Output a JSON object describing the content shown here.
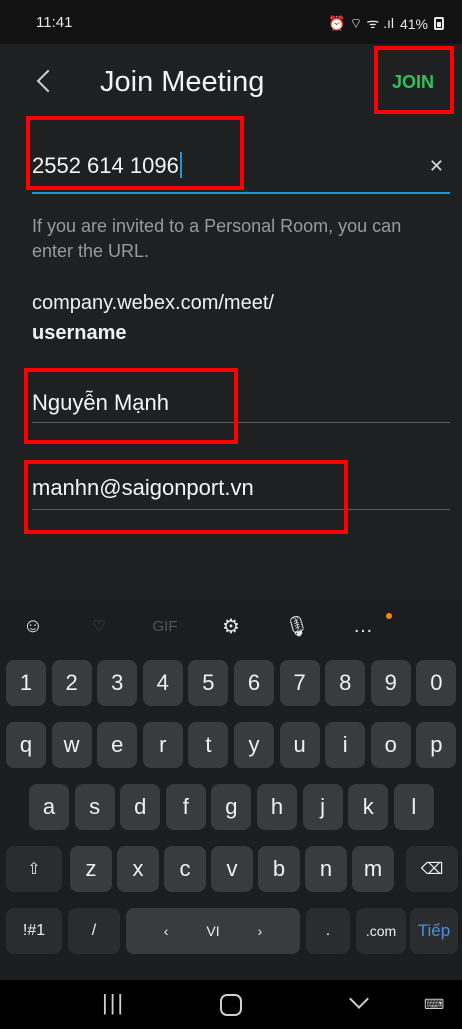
{
  "status": {
    "time": "11:41",
    "battery": "41%",
    "signal_icons": "⏰ ⌔ ᯤ .ıl"
  },
  "header": {
    "title": "Join Meeting",
    "join_label": "JOIN"
  },
  "form": {
    "meeting_number": "2552 614 1096",
    "hint": "If you are invited to a Personal Room, you can enter the URL.",
    "url_prefix": "company.webex.com/meet/",
    "url_suffix": "username",
    "name": "Nguyễn Mạnh",
    "email": "manhn@saigonport.vn"
  },
  "keyboard": {
    "toolbar": [
      "☺",
      "♡",
      "GIF",
      "⚙",
      "🎙",
      "…"
    ],
    "number_row": [
      "1",
      "2",
      "3",
      "4",
      "5",
      "6",
      "7",
      "8",
      "9",
      "0"
    ],
    "row1": [
      "q",
      "w",
      "e",
      "r",
      "t",
      "y",
      "u",
      "i",
      "o",
      "p"
    ],
    "row2": [
      "a",
      "s",
      "d",
      "f",
      "g",
      "h",
      "j",
      "k",
      "l"
    ],
    "row3": [
      "z",
      "x",
      "c",
      "v",
      "b",
      "n",
      "m"
    ],
    "symbols_label": "!#1",
    "slash_label": "/",
    "space_label": "VI",
    "period_label": ".",
    "dotcom_label": ".com",
    "next_label": "Tiếp",
    "shift_icon": "⇧",
    "delete_icon": "⌫"
  },
  "nav": {
    "recents": "|||",
    "keyboard_icon": "⌨"
  }
}
